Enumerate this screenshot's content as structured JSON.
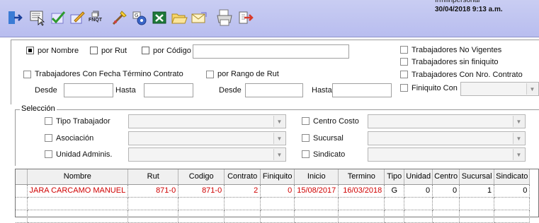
{
  "toolbar": {
    "form_name": "frmfinpersonal",
    "datetime": "30/04/2018 9:13 a.m.",
    "icons": [
      "exit-icon",
      "select-icon",
      "check-icon",
      "edit-icon",
      "finiquito-icon",
      "tools-icon",
      "settings-icon",
      "excel-icon",
      "folder-icon",
      "mail-icon",
      "print-icon",
      "export-icon"
    ],
    "finiquito_badge": "FNQT"
  },
  "filter": {
    "radio_nombre": "por Nombre",
    "radio_rut": "por Rut",
    "radio_codigo": "por Código",
    "search_value": "",
    "chk_fecha_termino": "Trabajadores Con Fecha Término Contrato",
    "chk_rango_rut": "por Rango de Rut",
    "desde_label": "Desde",
    "hasta_label": "Hasta",
    "desde_rut_label": "Desde",
    "hasta_rut_label": "Hasta",
    "chk_no_vigentes": "Trabajadores No Vigentes",
    "chk_sin_finiquito": "Trabajadores sin finiquito",
    "chk_nro_contrato": "Trabajadores Con Nro. Contrato",
    "chk_finiquito_con": "Finiquito Con"
  },
  "seleccion": {
    "title": "Selección",
    "tipo_trabajador": "Tipo Trabajador",
    "asociacion": "Asociación",
    "unidad_adminis": "Unidad Adminis.",
    "centro_costo": "Centro Costo",
    "sucursal": "Sucursal",
    "sindicato": "Sindicato"
  },
  "grid": {
    "columns": [
      "Nombre",
      "Rut",
      "Codigo",
      "Contrato",
      "Finiquito",
      "Inicio",
      "Termino",
      "Tipo",
      "Unidad",
      "Centro",
      "Sucursal",
      "Sindicato"
    ],
    "rows": [
      [
        "JARA CARCAMO MANUEL",
        "871-0",
        "871-0",
        "2",
        "0",
        "15/08/2017",
        "16/03/2018",
        "G",
        "0",
        "0",
        "1",
        "0"
      ]
    ]
  }
}
